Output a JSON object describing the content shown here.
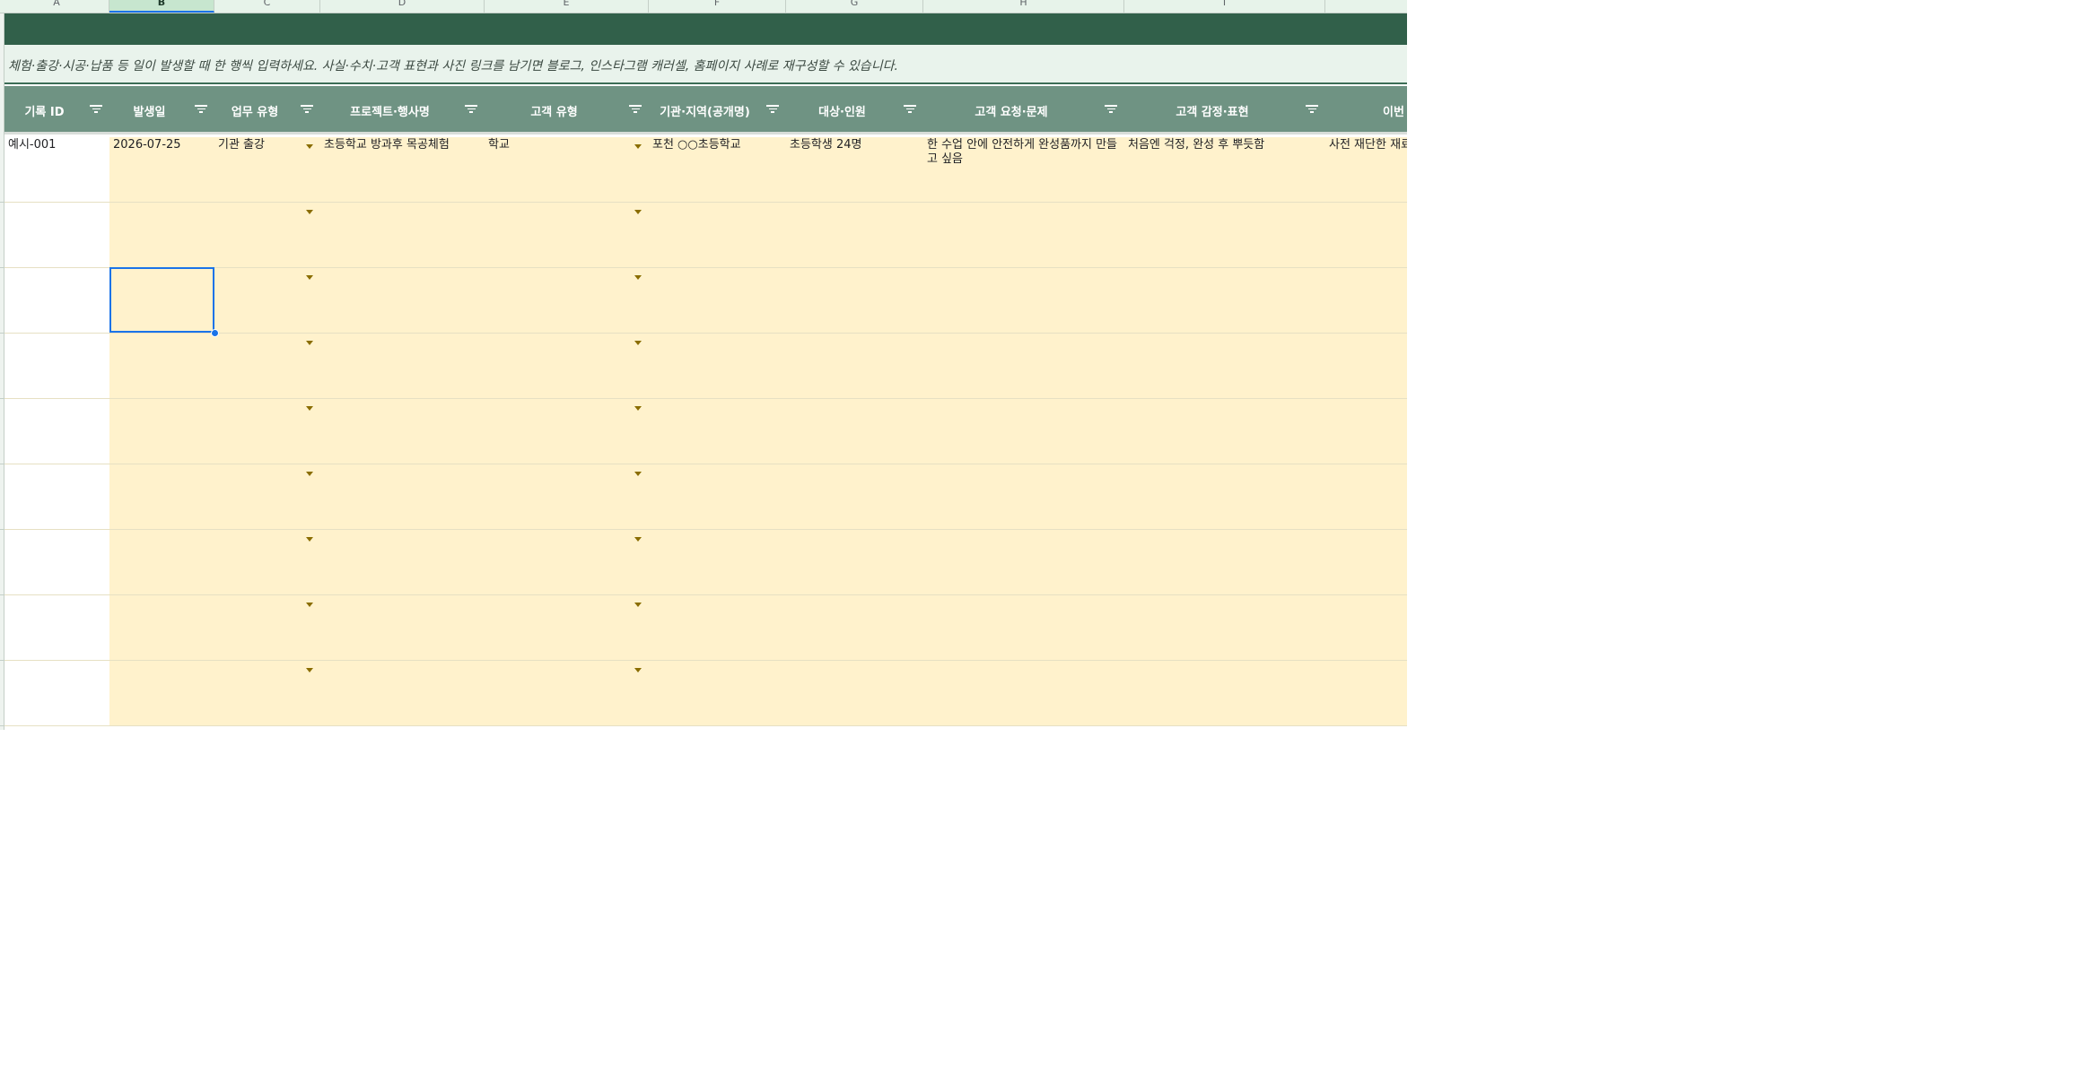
{
  "columns": [
    "A",
    "B",
    "C",
    "D",
    "E",
    "F",
    "G",
    "H",
    "I"
  ],
  "selected_column": "B",
  "note": "체험·출강·시공·납품 등 일이 발생할 때 한 행씩 입력하세요. 사실·수치·고객 표현과 사진 링크를 남기면 블로그, 인스타그램 캐러셀, 홈페이지 사례로 재구성할 수 있습니다.",
  "headers": [
    "기록 ID",
    "발생일",
    "업무 유형",
    "프로젝트·행사명",
    "고객 유형",
    "기관·지역(공개명)",
    "대상·인원",
    "고객 요청·문제",
    "고객 감정·표현",
    "이번"
  ],
  "rows": [
    {
      "id": "예시-001",
      "date": "2026-07-25",
      "type": "기관 출강",
      "project": "초등학교 방과후 목공체험",
      "customer_type": "학교",
      "region": "포천 ○○초등학교",
      "target": "초등학생 24명",
      "request": "한 수업 안에 안전하게 완성품까지 만들고 싶음",
      "emotion": "처음엔 걱정, 완성 후 뿌듯함",
      "action": "사전 재단한 재료 진행"
    },
    {
      "id": "",
      "date": "",
      "type": "",
      "project": "",
      "customer_type": "",
      "region": "",
      "target": "",
      "request": "",
      "emotion": "",
      "action": ""
    },
    {
      "id": "",
      "date": "",
      "type": "",
      "project": "",
      "customer_type": "",
      "region": "",
      "target": "",
      "request": "",
      "emotion": "",
      "action": ""
    },
    {
      "id": "",
      "date": "",
      "type": "",
      "project": "",
      "customer_type": "",
      "region": "",
      "target": "",
      "request": "",
      "emotion": "",
      "action": ""
    },
    {
      "id": "",
      "date": "",
      "type": "",
      "project": "",
      "customer_type": "",
      "region": "",
      "target": "",
      "request": "",
      "emotion": "",
      "action": ""
    },
    {
      "id": "",
      "date": "",
      "type": "",
      "project": "",
      "customer_type": "",
      "region": "",
      "target": "",
      "request": "",
      "emotion": "",
      "action": ""
    },
    {
      "id": "",
      "date": "",
      "type": "",
      "project": "",
      "customer_type": "",
      "region": "",
      "target": "",
      "request": "",
      "emotion": "",
      "action": ""
    },
    {
      "id": "",
      "date": "",
      "type": "",
      "project": "",
      "customer_type": "",
      "region": "",
      "target": "",
      "request": "",
      "emotion": "",
      "action": ""
    },
    {
      "id": "",
      "date": "",
      "type": "",
      "project": "",
      "customer_type": "",
      "region": "",
      "target": "",
      "request": "",
      "emotion": "",
      "action": ""
    }
  ],
  "colors": {
    "banner": "#31604a",
    "header": "#6f9383",
    "input_fill": "#fff2cc",
    "selection": "#1a73e8"
  }
}
